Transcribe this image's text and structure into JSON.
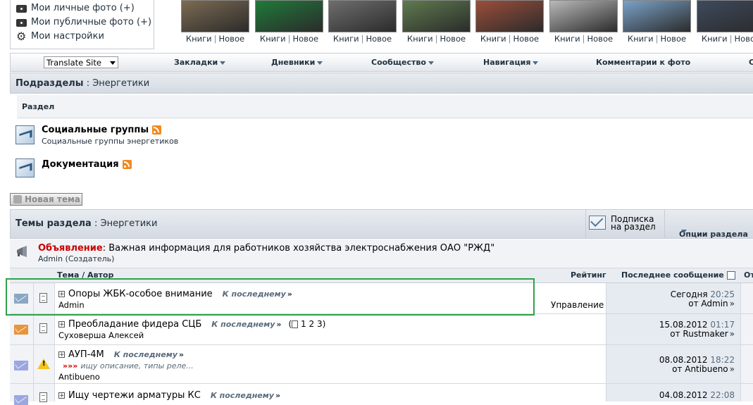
{
  "user_menu": [
    {
      "label": "Мои личные фото (+)",
      "icon": "camera-icon"
    },
    {
      "label": "Мои публичные фото (+)",
      "icon": "camera-icon"
    },
    {
      "label": "Мои настройки",
      "icon": "gear-icon"
    }
  ],
  "thumbnails": {
    "link1": "Книги",
    "link2": "Новое",
    "colors": [
      "#7d6b52",
      "#1f7a3a",
      "#6e6e6e",
      "#5f7b4e",
      "#9c4e3a",
      "#b9b9b9",
      "#7aa2c8",
      "#3e4a5e"
    ]
  },
  "navbar": {
    "translate": "Translate Site",
    "items": [
      "Закладки",
      "Дневники",
      "Сообщество",
      "Навигация",
      "Комментарии к фото",
      "С"
    ]
  },
  "subsections": {
    "title": "Подразделы",
    "forum": "Энергетики",
    "column_header": "Раздел",
    "forums": [
      {
        "title": "Социальные группы",
        "description": "Социальные группы энергетиков"
      },
      {
        "title": "Документация",
        "description": ""
      }
    ]
  },
  "new_topic_label": "Новая тема",
  "threads": {
    "title": "Темы раздела",
    "forum": "Энергетики",
    "subscribe_line1": "Подписка",
    "subscribe_line2": "на раздел",
    "options_label": "Опции раздела",
    "announcement": {
      "keyword": "Объявление",
      "text": "Важная информация для работников хозяйства электроснабжения ОАО \"РЖД\"",
      "author": "Admin (Создатель)"
    },
    "columns": {
      "topic": "Тема / Автор",
      "rating": "Рейтинг",
      "last_post": "Последнее сообщение",
      "extra": "От"
    },
    "to_last_label": "К последнему",
    "rows": [
      {
        "title": "Опоры ЖБК-особое внимание",
        "author": "Admin",
        "rating": "Управление",
        "date": "Сегодня",
        "time": "20:25",
        "by": "от Admin",
        "pages": "",
        "preview": "",
        "status_color": "#8aa6c4",
        "warn": false
      },
      {
        "title": "Преобладание фидера СЦБ",
        "author": "Суховерша Алексей",
        "rating": "",
        "date": "15.08.2012",
        "time": "01:17",
        "by": "от Rustmaker",
        "pages": "1 2 3",
        "preview": "",
        "status_color": "#e8943a",
        "warn": false
      },
      {
        "title": "АУП-4М",
        "author": "Antibueno",
        "rating": "",
        "date": "08.08.2012",
        "time": "18:22",
        "by": "от Antibueno",
        "pages": "",
        "preview": "ищу описание, типы реле...",
        "status_color": "#9aa7e0",
        "warn": true
      },
      {
        "title": "Ищу чертежи арматуры КС",
        "author": "",
        "rating": "",
        "date": "04.08.2012",
        "time": "22:08",
        "by": "",
        "pages": "",
        "preview": "",
        "status_color": "#9aa7e0",
        "warn": false
      }
    ]
  }
}
